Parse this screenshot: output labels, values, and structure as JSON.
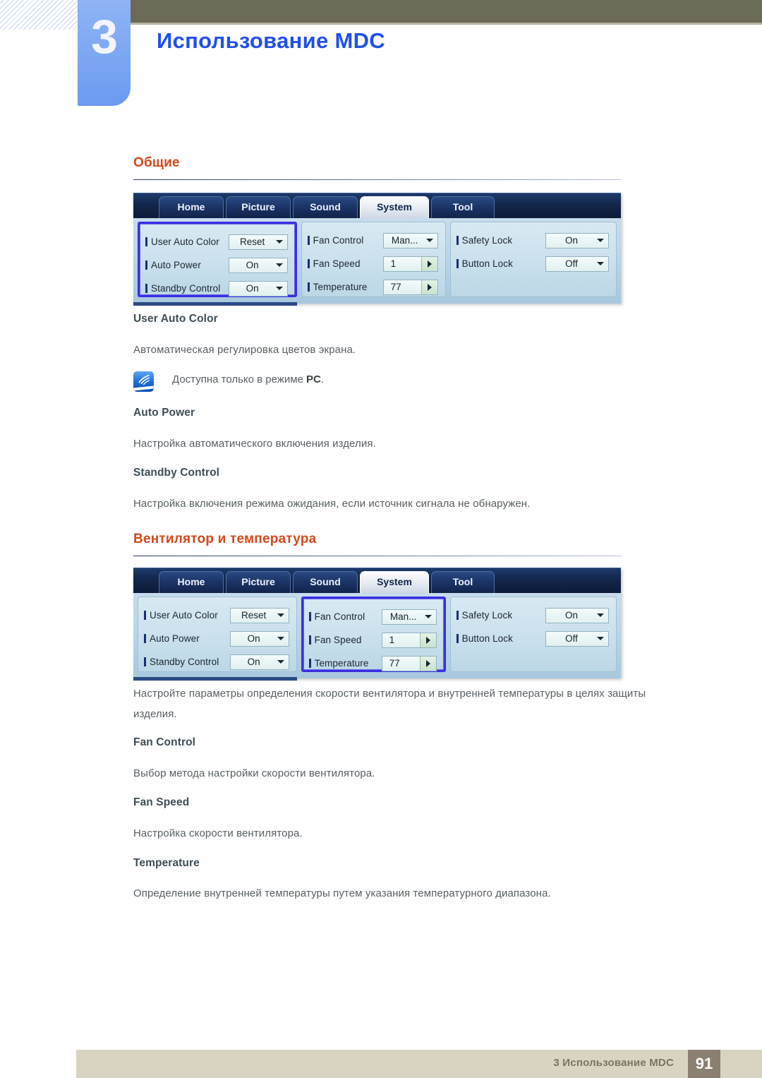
{
  "header": {
    "chapter_number": "3",
    "chapter_title": "Использование MDC"
  },
  "sections": [
    {
      "title": "Общие",
      "items": [
        {
          "name": "User Auto Color",
          "desc": "Автоматическая регулировка цветов экрана."
        },
        {
          "name": "Auto Power",
          "desc": "Настройка автоматического включения изделия."
        },
        {
          "name": "Standby Control",
          "desc": "Настройка включения режима ожидания, если источник сигнала не обнаружен."
        }
      ],
      "note": {
        "icon": "note-pen-icon",
        "text_before": "Доступна только в режиме ",
        "text_bold": "PC",
        "text_after": "."
      }
    },
    {
      "title": "Вентилятор и температура",
      "intro": "Настройте параметры определения скорости вентилятора и внутренней температуры в целях защиты изделия.",
      "items": [
        {
          "name": "Fan Control",
          "desc": "Выбор метода настройки скорости вентилятора."
        },
        {
          "name": "Fan Speed",
          "desc": "Настройка скорости вентилятора."
        },
        {
          "name": "Temperature",
          "desc": "Определение внутренней температуры путем указания температурного диапазона."
        }
      ]
    }
  ],
  "mdc": {
    "tabs": [
      {
        "label": "Home",
        "active": false
      },
      {
        "label": "Picture",
        "active": false
      },
      {
        "label": "Sound",
        "active": false
      },
      {
        "label": "System",
        "active": true
      },
      {
        "label": "Tool",
        "active": false
      }
    ],
    "columns": [
      {
        "id": "general",
        "rows": [
          {
            "label": "User Auto Color",
            "value": "Reset",
            "control": "dropdown"
          },
          {
            "label": "Auto Power",
            "value": "On",
            "control": "dropdown"
          },
          {
            "label": "Standby Control",
            "value": "On",
            "control": "dropdown"
          }
        ]
      },
      {
        "id": "fan-temperature",
        "rows": [
          {
            "label": "Fan Control",
            "value": "Man...",
            "control": "dropdown"
          },
          {
            "label": "Fan Speed",
            "value": "1",
            "control": "spinner"
          },
          {
            "label": "Temperature",
            "value": "77",
            "control": "spinner"
          }
        ]
      },
      {
        "id": "lock",
        "rows": [
          {
            "label": "Safety Lock",
            "value": "On",
            "control": "dropdown"
          },
          {
            "label": "Button Lock",
            "value": "Off",
            "control": "dropdown"
          }
        ]
      }
    ],
    "screenshot_1_highlight": "general",
    "screenshot_2_highlight": "fan-temperature"
  },
  "footer": {
    "text": "3 Использование MDC",
    "page": "91"
  },
  "colors": {
    "accent_heading": "#d4481b",
    "chapter_blue": "#2050e8",
    "olive": "#6b6a56",
    "highlight_border": "#3a2fe0",
    "footer_bg": "#d9d3c2",
    "page_box": "#8b7f72"
  }
}
